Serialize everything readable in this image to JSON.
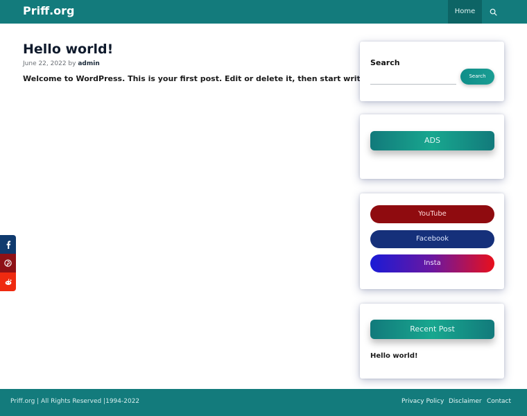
{
  "header": {
    "site_title": "Priff.org",
    "nav_home": "Home",
    "search_icon": "search-icon",
    "color": "#137b7c"
  },
  "post": {
    "title": "Hello world!",
    "date": "June 22, 2022",
    "by": "by",
    "author": "admin",
    "content": "Welcome to WordPress. This is your first post. Edit or delete it, then start writing!"
  },
  "sidebar": {
    "search": {
      "title": "Search",
      "placeholder": "",
      "button": "Search"
    },
    "ads": {
      "label": "ADS"
    },
    "social": {
      "youtube": "YouTube",
      "facebook": "Facebook",
      "insta": "Insta"
    },
    "recent": {
      "title": "Recent Post",
      "items": [
        "Hello world!"
      ]
    }
  },
  "share": {
    "icons": [
      "facebook-icon",
      "pinterest-icon",
      "reddit-icon"
    ]
  },
  "footer": {
    "copyright": "Priff.org | All Rights Reserved |1994-2022",
    "links": [
      "Privacy Policy",
      "Disclaimer",
      "Contact"
    ]
  }
}
